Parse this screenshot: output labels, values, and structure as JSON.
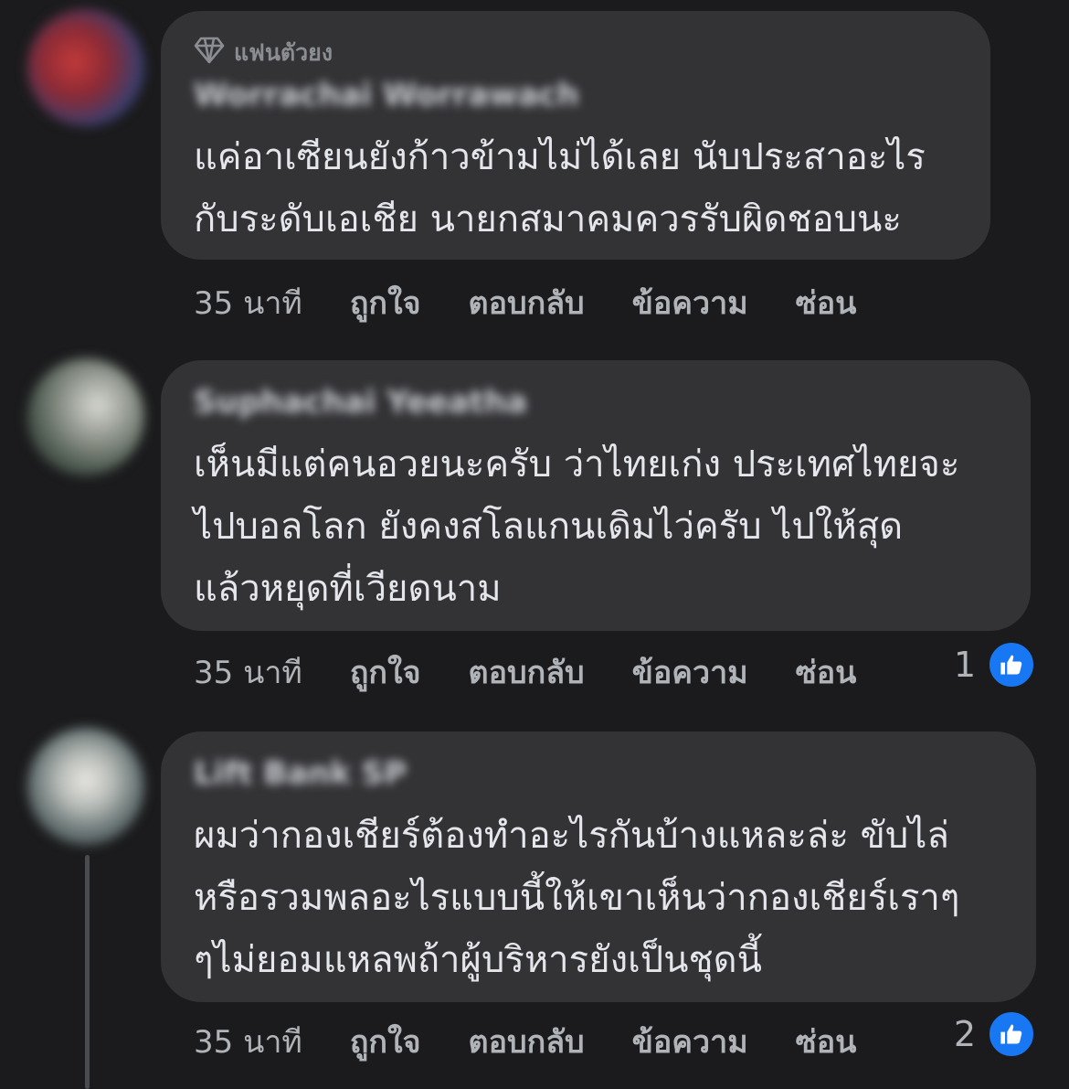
{
  "comments": [
    {
      "badge": "แฟนตัวยง",
      "name": "Worrachai Worrawach",
      "lines": [
        "แค่อาเซียนยังก้าวข้ามไม่ได้เลย นับประสาอะไร",
        "กับระดับเอเชีย นายกสมาคมควรรับผิดชอบนะ"
      ],
      "time": "35 นาที",
      "actions": [
        "ถูกใจ",
        "ตอบกลับ",
        "ข้อความ",
        "ซ่อน"
      ],
      "reaction_count": ""
    },
    {
      "name": "Suphachai Yeeatha",
      "lines": [
        "เห็นมีแต่คนอวยนะครับ ว่าไทยเก่ง ประเทศไทยจะ",
        "ไปบอลโลก ยังคงสโลแกนเดิมไว่ครับ ไปให้สุด",
        "แล้วหยุดที่เวียดนาม"
      ],
      "time": "35 นาที",
      "actions": [
        "ถูกใจ",
        "ตอบกลับ",
        "ข้อความ",
        "ซ่อน"
      ],
      "reaction_count": "1"
    },
    {
      "name": "Lift Bank SP",
      "lines": [
        "ผมว่ากองเชียร์ต้องทำอะไรกันบ้างแหละล่ะ ขับไล่",
        "หรือรวมพลอะไรแบบนี้ให้เขาเห็นว่ากองเชียร์เราๆ",
        "ๆไม่ยอมแหลพถ้าผู้บริหารยังเป็นชุดนี้"
      ],
      "time": "35 นาที",
      "actions": [
        "ถูกใจ",
        "ตอบกลับ",
        "ข้อความ",
        "ซ่อน"
      ],
      "reaction_count": "2"
    }
  ],
  "icons": {
    "badge": "diamond-icon",
    "reaction": "thumbs-up-icon"
  },
  "colors": {
    "background": "#1b1b1d",
    "bubble": "#333336",
    "like_blue": "#1877f2"
  }
}
